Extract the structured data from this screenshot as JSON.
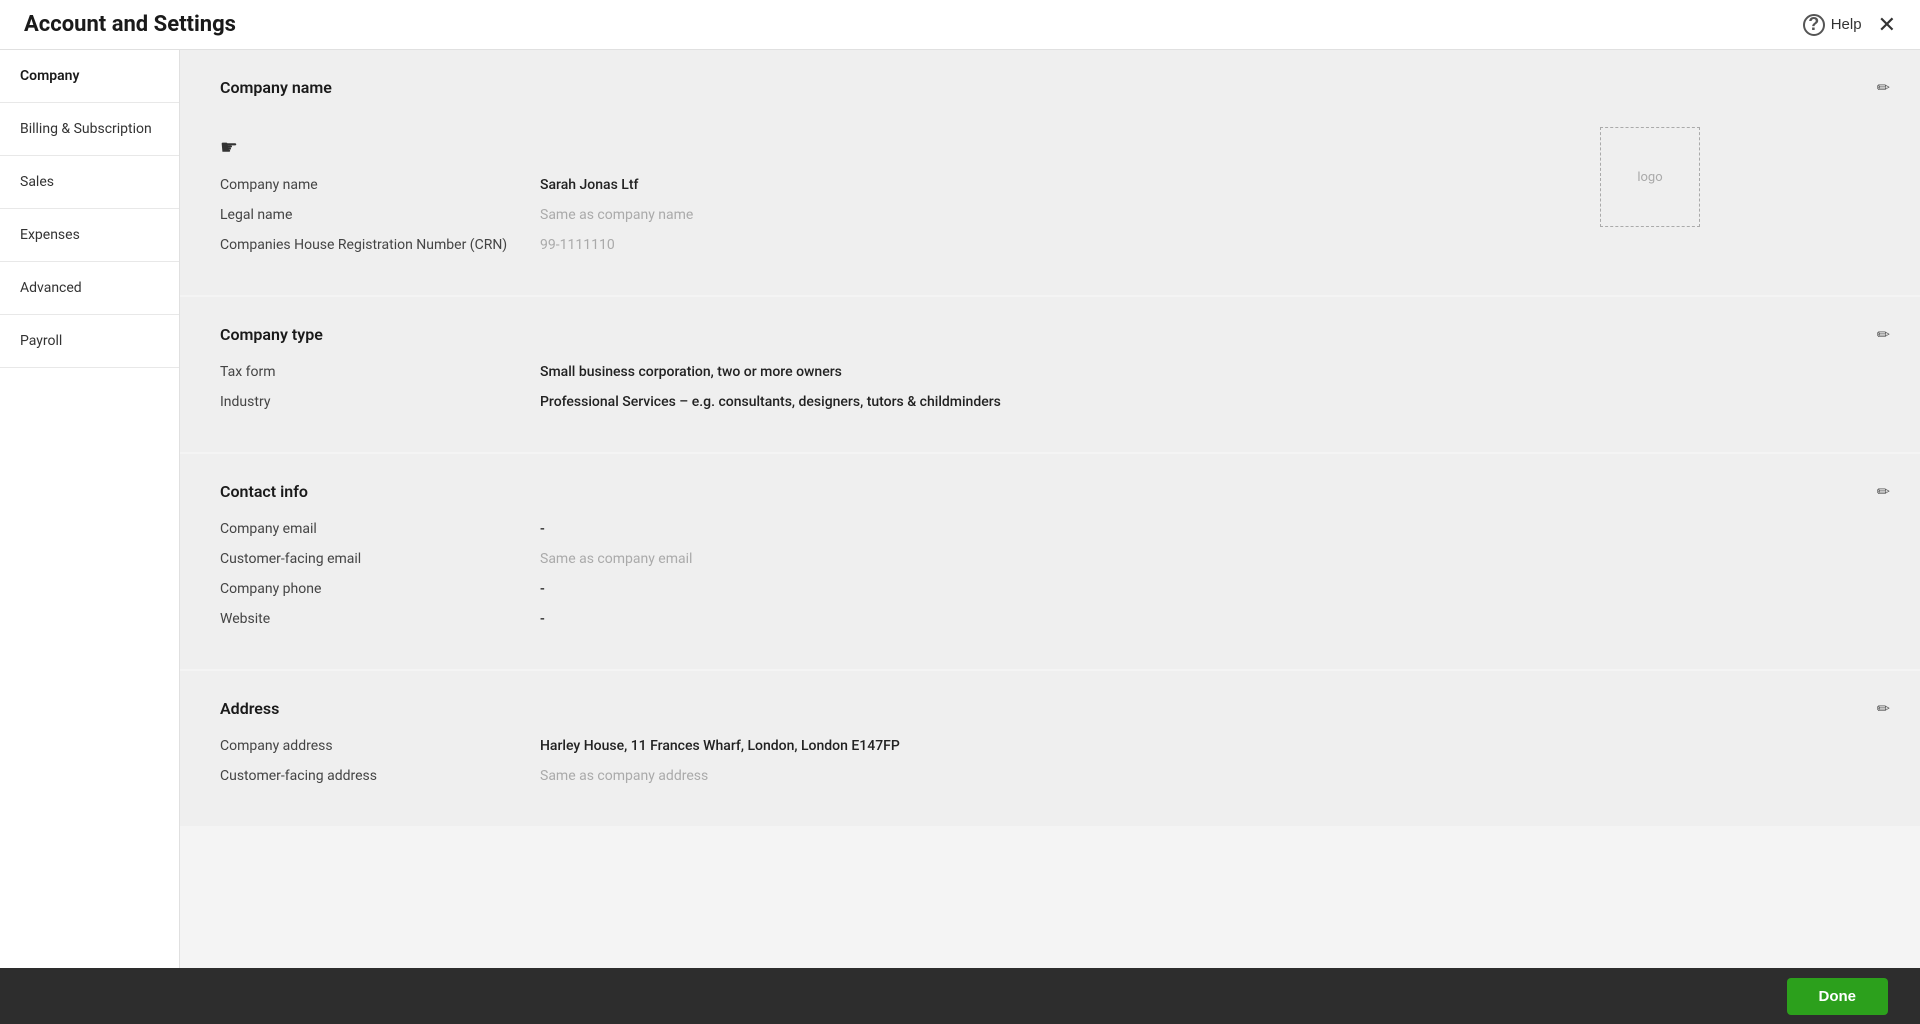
{
  "header": {
    "title": "Account and Settings",
    "help_label": "Help",
    "close_label": "✕"
  },
  "sidebar": {
    "items": [
      {
        "id": "company",
        "label": "Company",
        "active": true
      },
      {
        "id": "billing",
        "label": "Billing & Subscription",
        "active": false
      },
      {
        "id": "sales",
        "label": "Sales",
        "active": false
      },
      {
        "id": "expenses",
        "label": "Expenses",
        "active": false
      },
      {
        "id": "advanced",
        "label": "Advanced",
        "active": false
      },
      {
        "id": "payroll",
        "label": "Payroll",
        "active": false
      }
    ]
  },
  "sections": {
    "company_name": {
      "heading": "Company name",
      "logo_placeholder": "logo",
      "fields": [
        {
          "label": "Company name",
          "value": "Sarah Jonas Ltf",
          "placeholder": false
        },
        {
          "label": "Legal name",
          "value": "Same as company name",
          "placeholder": true
        },
        {
          "label": "Companies House Registration Number (CRN)",
          "value": "99-1111110",
          "placeholder": true
        }
      ]
    },
    "company_type": {
      "heading": "Company type",
      "fields": [
        {
          "label": "Tax form",
          "value": "Small business corporation, two or more owners",
          "placeholder": false
        },
        {
          "label": "Industry",
          "value": "Professional Services – e.g. consultants, designers, tutors & childminders",
          "placeholder": false
        }
      ]
    },
    "contact_info": {
      "heading": "Contact info",
      "fields": [
        {
          "label": "Company email",
          "value": "-",
          "placeholder": false
        },
        {
          "label": "Customer-facing email",
          "value": "Same as company email",
          "placeholder": true
        },
        {
          "label": "Company phone",
          "value": "-",
          "placeholder": false
        },
        {
          "label": "Website",
          "value": "-",
          "placeholder": false
        }
      ]
    },
    "address": {
      "heading": "Address",
      "fields": [
        {
          "label": "Company address",
          "value": "Harley House, 11 Frances Wharf, London, London E147FP",
          "placeholder": false
        },
        {
          "label": "Customer-facing address",
          "value": "Same as company address",
          "placeholder": true
        }
      ]
    }
  },
  "bottom_bar": {
    "done_label": "Done"
  },
  "icons": {
    "help": "?",
    "close": "✕",
    "edit": "✏"
  }
}
